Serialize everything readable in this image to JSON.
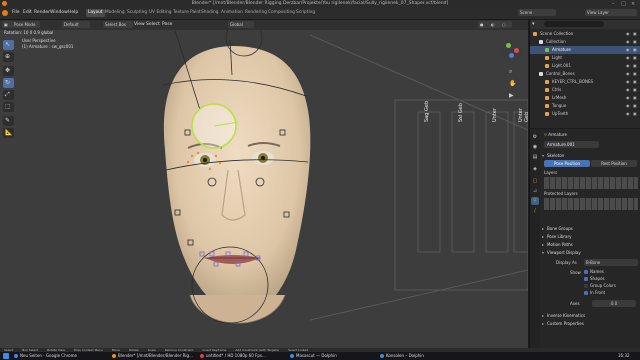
{
  "window": {
    "title": "Blender* [/mnt/Blender/Blender Rigging Derzbar/Projekte/You rigilenek/facial/Sully_rigilenek_07_Shaper.xcf/blend]"
  },
  "menu": {
    "items": [
      "File",
      "Edit",
      "Render",
      "Window",
      "Help"
    ],
    "workspaces": [
      "Layout",
      "Modeling",
      "Sculpting",
      "UV Editing",
      "Texture Paint",
      "Shading",
      "Animation",
      "Rendering",
      "Compositing",
      "Scripting"
    ],
    "active_workspace": "Layout",
    "scene_label": "Scene",
    "view_layer_label": "View Layer"
  },
  "viewport_header": {
    "mode": "Pose Mode",
    "orientation": "Default",
    "drag": "Select Box",
    "menus": [
      "View",
      "Select",
      "Pose"
    ],
    "transform": "Global"
  },
  "viewport": {
    "perspective_label": "User Perspective",
    "object_label": "(1) Armature : sw_gsc001",
    "position_readout": "Rotation: 10 0 0.9 global",
    "labels": [
      "Sag Geb",
      "Ssl Geb",
      "Unter",
      "Unter Geb"
    ]
  },
  "outliner": {
    "header": "Scene Collection",
    "rows": [
      {
        "name": "Scene Collection",
        "indent": 0,
        "selected": false
      },
      {
        "name": "Collection",
        "indent": 1,
        "selected": false
      },
      {
        "name": "Armature",
        "indent": 2,
        "selected": true
      },
      {
        "name": "Light",
        "indent": 2,
        "selected": false
      },
      {
        "name": "Light.001",
        "indent": 2,
        "selected": false
      },
      {
        "name": "Control_Bones",
        "indent": 1,
        "selected": false
      },
      {
        "name": "KEYER_CTRL_BONES",
        "indent": 2,
        "selected": false
      },
      {
        "name": "Ctrls",
        "indent": 2,
        "selected": false
      },
      {
        "name": "LrMesh",
        "indent": 2,
        "selected": false
      },
      {
        "name": "Tongue",
        "indent": 2,
        "selected": false
      },
      {
        "name": "UpTeeth",
        "indent": 2,
        "selected": false
      }
    ]
  },
  "properties": {
    "breadcrumb": "Armature",
    "data_name": "Armature.001",
    "skeleton": "Skeleton",
    "pose_position": "Pose Position",
    "rest_position": "Rest Position",
    "layers": "Layers",
    "protected_layers": "Protected Layers",
    "sections": [
      "Bone Groups",
      "Pose Library",
      "Motion Paths",
      "Viewport Display"
    ],
    "display_as": "Display As",
    "display_value": "B-Bone",
    "show": "Show",
    "checks": [
      "Names",
      "Shapes",
      "Group Colors",
      "In Front"
    ],
    "axes": "Axes",
    "axes_value": "0.0",
    "more_sections": [
      "Inverse Kinematics",
      "Custom Properties"
    ]
  },
  "statusbar": {
    "items": [
      "Select",
      "Box Select",
      "Rotate View",
      "Pose Context Menu",
      "Move",
      "Rotate",
      "Scale",
      "Remove Constraint",
      "Insert Keyframe",
      "Add Constraint (with Targets)",
      "Select Linked"
    ]
  },
  "taskbar": {
    "items": [
      {
        "label": "Neu Seiten - Google Chrome",
        "color": "#4285f4"
      },
      {
        "label": "Blender* [/mnt/Blender/Blender Rig...",
        "color": "#f58a2a"
      },
      {
        "label": "untitled* / HD 1080p 60 Fps...",
        "color": "#d54242"
      },
      {
        "label": "Masascut — Dolphin",
        "color": "#3b8fd9"
      },
      {
        "label": "Konsolen – Dolphin",
        "color": "#3b8fd9"
      }
    ],
    "clock": "16:32"
  }
}
